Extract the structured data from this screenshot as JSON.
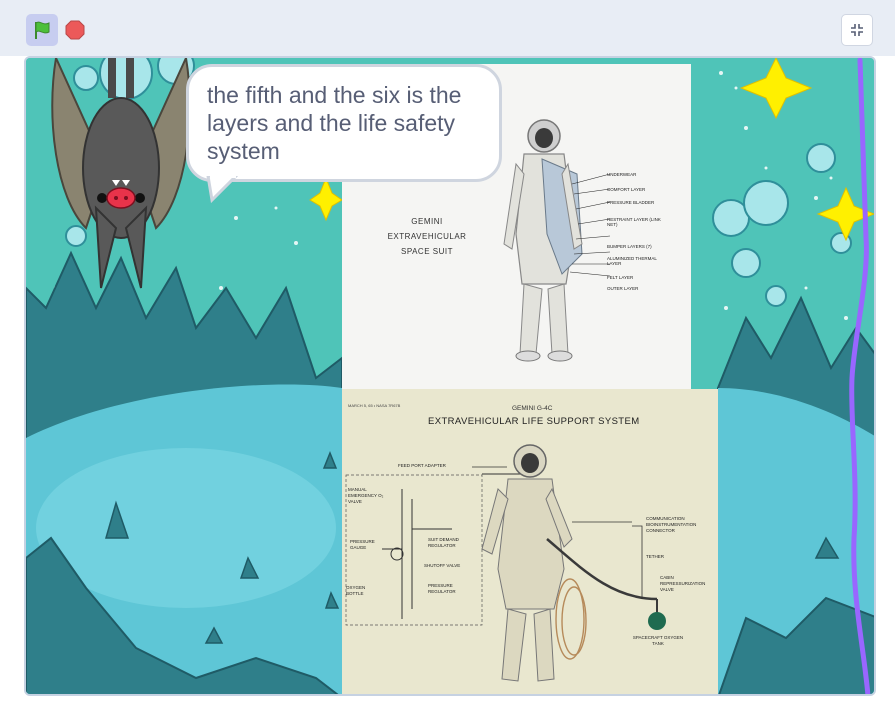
{
  "toolbar": {
    "green_flag": "green-flag-icon",
    "stop": "stop-icon",
    "fullscreen": "exit-fullscreen-icon"
  },
  "sprite": {
    "name": "bat",
    "speech": "the fifth and the six is the layers and the life safety system"
  },
  "photo1": {
    "title_line1": "GEMINI",
    "title_line2": "EXTRAVEHICULAR",
    "title_line3": "SPACE SUIT",
    "labels": [
      "UNDERWEAR",
      "COMFORT LAYER",
      "PRESSURE BLADDER",
      "RESTRAINT LAYER (LINK NET)",
      "BUMPER LAYERS (7)",
      "ALUMINIZED THERMAL LAYER",
      "FELT LAYER",
      "OUTER LAYER"
    ]
  },
  "photo2": {
    "code": "MARCH 5, 65 • NASA  7R67B",
    "model": "GEMINI G-4C",
    "title": "EXTRAVEHICULAR LIFE SUPPORT SYSTEM",
    "labels": {
      "feed_port": "FEED PORT ADAPTER",
      "manual_emergency": "MANUAL EMERGENCY O₂ VALVE",
      "pressure_gauge": "PRESSURE GAUGE",
      "suit_demand": "SUIT DEMAND REGULATOR",
      "shutoff": "SHUTOFF VALVE",
      "oxygen_bottle": "OXYGEN BOTTLE",
      "pressure_regulator": "PRESSURE REGULATOR",
      "communication": "COMMUNICATION BIOINSTRUMENTATION CONNECTOR",
      "tether": "TETHER",
      "cabin_valve": "CABIN REPRESSURIZATION VALVE",
      "tank": "SPACECRAFT OXYGEN TANK"
    }
  },
  "colors": {
    "sky": "#4fc4b8",
    "mountain": "#2f7f8a",
    "ground": "#5ec6d6",
    "pen_line": "#9966ff",
    "flag_bg": "#c7cdf0"
  }
}
